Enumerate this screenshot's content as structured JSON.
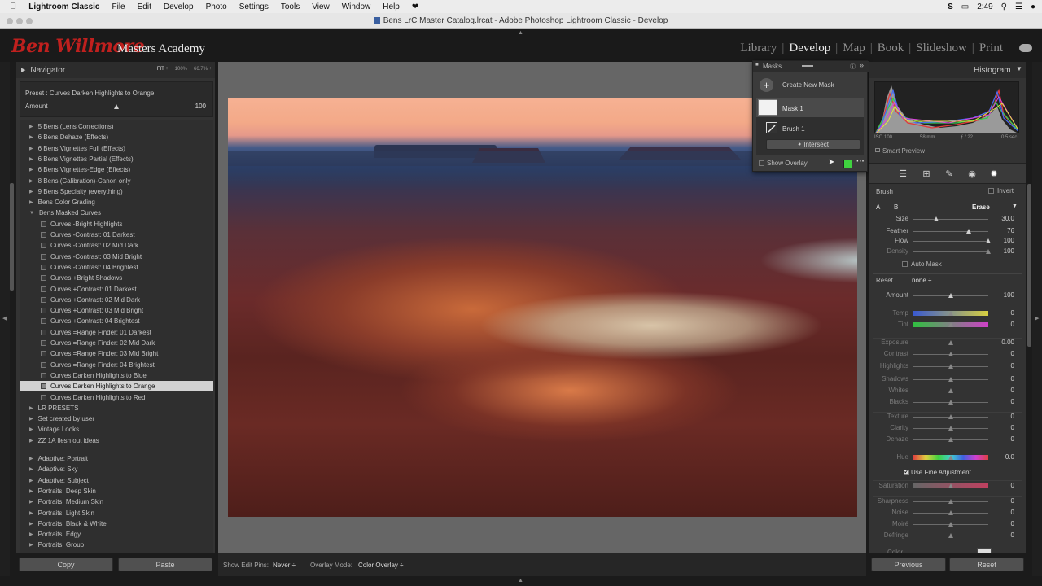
{
  "menubar": {
    "app": "Lightroom Classic",
    "items": [
      "File",
      "Edit",
      "Develop",
      "Photo",
      "Settings",
      "Tools",
      "View",
      "Window",
      "Help"
    ],
    "time": "2:49"
  },
  "window": {
    "title": "Bens LrC Master Catalog.lrcat - Adobe Photoshop Lightroom Classic - Develop"
  },
  "identity": {
    "script": "Ben Willmore",
    "rest": "Masters Academy"
  },
  "modules": [
    {
      "label": "Library",
      "active": false
    },
    {
      "label": "Develop",
      "active": true
    },
    {
      "label": "Map",
      "active": false
    },
    {
      "label": "Book",
      "active": false
    },
    {
      "label": "Slideshow",
      "active": false
    },
    {
      "label": "Print",
      "active": false
    }
  ],
  "navigator": {
    "title": "Navigator",
    "zoom": [
      "FIT ÷",
      "100%",
      "66.7% ÷"
    ]
  },
  "preset_info": {
    "prefix": "Preset :",
    "name": "Curves Darken Highlights to Orange",
    "amount_label": "Amount",
    "amount_value": "100",
    "amount_fraction": 0.43
  },
  "presets": [
    {
      "label": "5 Bens (Lens Corrections)",
      "kind": "folder"
    },
    {
      "label": "6 Bens Dehaze (Effects)",
      "kind": "folder"
    },
    {
      "label": "6 Bens Vignettes Full (Effects)",
      "kind": "folder"
    },
    {
      "label": "6 Bens Vignettes Partial (Effects)",
      "kind": "folder"
    },
    {
      "label": "6 Bens Vignettes-Edge (Effects)",
      "kind": "folder"
    },
    {
      "label": "8 Bens (Calibration)-Canon only",
      "kind": "folder"
    },
    {
      "label": "9 Bens Specialty (everything)",
      "kind": "folder"
    },
    {
      "label": "Bens Color Grading",
      "kind": "folder"
    },
    {
      "label": "Bens Masked Curves",
      "kind": "open"
    },
    {
      "label": "Curves -Bright Highlights",
      "kind": "item"
    },
    {
      "label": "Curves -Contrast: 01 Darkest",
      "kind": "item"
    },
    {
      "label": "Curves -Contrast: 02 Mid Dark",
      "kind": "item"
    },
    {
      "label": "Curves -Contrast: 03 Mid Bright",
      "kind": "item"
    },
    {
      "label": "Curves -Contrast: 04 Brightest",
      "kind": "item"
    },
    {
      "label": "Curves +Bright Shadows",
      "kind": "item"
    },
    {
      "label": "Curves +Contrast: 01 Darkest",
      "kind": "item"
    },
    {
      "label": "Curves +Contrast: 02 Mid Dark",
      "kind": "item"
    },
    {
      "label": "Curves +Contrast: 03 Mid Bright",
      "kind": "item"
    },
    {
      "label": "Curves +Contrast: 04 Brightest",
      "kind": "item"
    },
    {
      "label": "Curves =Range Finder: 01 Darkest",
      "kind": "item"
    },
    {
      "label": "Curves =Range Finder: 02 Mid Dark",
      "kind": "item"
    },
    {
      "label": "Curves =Range Finder: 03 Mid Bright",
      "kind": "item"
    },
    {
      "label": "Curves =Range Finder: 04 Brightest",
      "kind": "item"
    },
    {
      "label": "Curves Darken Highlights to Blue",
      "kind": "item"
    },
    {
      "label": "Curves Darken Highlights to Orange",
      "kind": "item",
      "selected": true
    },
    {
      "label": "Curves Darken Highlights to Red",
      "kind": "item"
    },
    {
      "label": "LR PRESETS",
      "kind": "folder"
    },
    {
      "label": "Set created by user",
      "kind": "folder"
    },
    {
      "label": "Vintage Looks",
      "kind": "folder"
    },
    {
      "label": "ZZ 1A flesh out ideas",
      "kind": "folder"
    },
    {
      "label": "Adaptive: Portrait",
      "kind": "folder",
      "gap": true
    },
    {
      "label": "Adaptive: Sky",
      "kind": "folder"
    },
    {
      "label": "Adaptive: Subject",
      "kind": "folder"
    },
    {
      "label": "Portraits: Deep Skin",
      "kind": "folder"
    },
    {
      "label": "Portraits: Medium Skin",
      "kind": "folder"
    },
    {
      "label": "Portraits: Light Skin",
      "kind": "folder"
    },
    {
      "label": "Portraits: Black & White",
      "kind": "folder"
    },
    {
      "label": "Portraits: Edgy",
      "kind": "folder"
    },
    {
      "label": "Portraits: Group",
      "kind": "folder"
    }
  ],
  "left_buttons": {
    "copy": "Copy",
    "paste": "Paste"
  },
  "toolbar": {
    "edit_pins_label": "Show Edit Pins:",
    "edit_pins_value": "Never ÷",
    "overlay_label": "Overlay Mode:",
    "overlay_value": "Color Overlay ÷"
  },
  "masks": {
    "title": "Masks",
    "create": "Create New Mask",
    "mask1": "Mask 1",
    "brush1": "Brush 1",
    "intersect": "Intersect",
    "show_overlay": "Show Overlay",
    "overlay_color": "#3fd23f"
  },
  "histogram": {
    "title": "Histogram",
    "iso": "ISO 100",
    "focal": "58 mm",
    "aperture": "ƒ / 22",
    "shutter": "0.5 sec",
    "smart_preview": "Smart Preview"
  },
  "brush": {
    "title": "Brush",
    "invert": "Invert",
    "a": "A",
    "b": "B",
    "erase": "Erase",
    "size_label": "Size",
    "size_value": "30.0",
    "size_pos": 0.3,
    "feather_label": "Feather",
    "feather_value": "76",
    "feather_pos": 0.74,
    "flow_label": "Flow",
    "flow_value": "100",
    "flow_pos": 1.0,
    "density_label": "Density",
    "density_value": "100",
    "density_pos": 1.0,
    "automask": "Auto Mask"
  },
  "adjust": {
    "reset_label": "Reset",
    "reset_value": "none ÷",
    "amount": {
      "label": "Amount",
      "value": "100"
    },
    "temp": {
      "label": "Temp",
      "value": "0"
    },
    "tint": {
      "label": "Tint",
      "value": "0"
    },
    "exposure": {
      "label": "Exposure",
      "value": "0.00"
    },
    "contrast": {
      "label": "Contrast",
      "value": "0"
    },
    "highlights": {
      "label": "Highlights",
      "value": "0"
    },
    "shadows": {
      "label": "Shadows",
      "value": "0"
    },
    "whites": {
      "label": "Whites",
      "value": "0"
    },
    "blacks": {
      "label": "Blacks",
      "value": "0"
    },
    "texture": {
      "label": "Texture",
      "value": "0"
    },
    "clarity": {
      "label": "Clarity",
      "value": "0"
    },
    "dehaze": {
      "label": "Dehaze",
      "value": "0"
    },
    "hue": {
      "label": "Hue",
      "value": "0.0"
    },
    "fine": "Use Fine Adjustment",
    "saturation": {
      "label": "Saturation",
      "value": "0"
    },
    "sharpness": {
      "label": "Sharpness",
      "value": "0"
    },
    "noise": {
      "label": "Noise",
      "value": "0"
    },
    "moire": {
      "label": "Moiré",
      "value": "0"
    },
    "defringe": {
      "label": "Defringe",
      "value": "0"
    },
    "color": {
      "label": "Color"
    }
  },
  "right_buttons": {
    "previous": "Previous",
    "reset": "Reset"
  }
}
